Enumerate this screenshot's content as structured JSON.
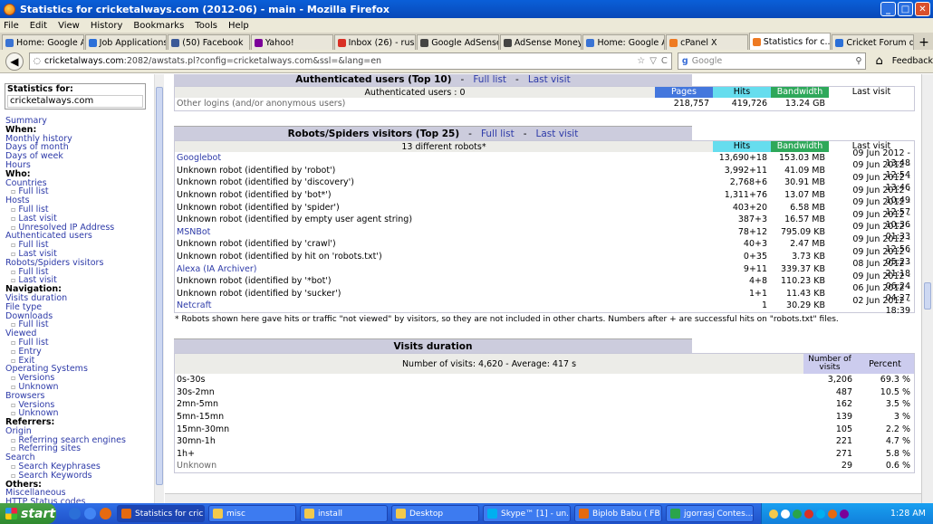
{
  "window": {
    "title": "Statistics for cricketalways.com (2012-06) - main - Mozilla Firefox",
    "btns": [
      "_",
      "□",
      "✕"
    ]
  },
  "menu": [
    "File",
    "Edit",
    "View",
    "History",
    "Bookmarks",
    "Tools",
    "Help"
  ],
  "tabs": [
    {
      "label": "Home: Google Ad...",
      "color": "#3a73d4",
      "active": false
    },
    {
      "label": "Job Applications -...",
      "color": "#2b6fd8",
      "active": false
    },
    {
      "label": "(50) Facebook",
      "color": "#3b5998",
      "active": false
    },
    {
      "label": "Yahoo!",
      "color": "#7b0099",
      "active": false
    },
    {
      "label": "Inbox (26) - russ...",
      "color": "#d93025",
      "active": false
    },
    {
      "label": "Google AdSense ...",
      "color": "#444444",
      "active": false
    },
    {
      "label": "AdSense Money: ...",
      "color": "#444444",
      "active": false
    },
    {
      "label": "Home: Google Ad...",
      "color": "#3a73d4",
      "active": false
    },
    {
      "label": "cPanel X",
      "color": "#ee7a22",
      "active": false
    },
    {
      "label": "Statistics for c...",
      "color": "#ee7a22",
      "active": true
    },
    {
      "label": "Cricket Forum dis...",
      "color": "#2b6fd8",
      "active": false
    }
  ],
  "new_tab": "+",
  "nav": {
    "url_host": "cricketalways.com",
    "url_rest": ":2082/awstats.pl?config=cricketalways.com&ssl=&lang=en",
    "search_placeholder": "Google",
    "feedback": "Feedback",
    "star": "☆",
    "drop": "▽",
    "reload": "C"
  },
  "sidebar": {
    "stat_label": "Statistics for:",
    "stat_value": "cricketalways.com",
    "items": [
      {
        "t": "Summary",
        "k": "link"
      },
      {
        "t": "When:",
        "k": "h"
      },
      {
        "t": "Monthly history",
        "k": "link"
      },
      {
        "t": "Days of month",
        "k": "link"
      },
      {
        "t": "Days of week",
        "k": "link"
      },
      {
        "t": "Hours",
        "k": "link"
      },
      {
        "t": "Who:",
        "k": "h"
      },
      {
        "t": "Countries",
        "k": "link"
      },
      {
        "t": "Full list",
        "k": "sub"
      },
      {
        "t": "Hosts",
        "k": "link"
      },
      {
        "t": "Full list",
        "k": "sub"
      },
      {
        "t": "Last visit",
        "k": "sub"
      },
      {
        "t": "Unresolved IP Address",
        "k": "sub"
      },
      {
        "t": "Authenticated users",
        "k": "link"
      },
      {
        "t": "Full list",
        "k": "sub"
      },
      {
        "t": "Last visit",
        "k": "sub"
      },
      {
        "t": "Robots/Spiders visitors",
        "k": "link"
      },
      {
        "t": "Full list",
        "k": "sub"
      },
      {
        "t": "Last visit",
        "k": "sub"
      },
      {
        "t": "Navigation:",
        "k": "h"
      },
      {
        "t": "Visits duration",
        "k": "link"
      },
      {
        "t": "File type",
        "k": "link"
      },
      {
        "t": "Downloads",
        "k": "link"
      },
      {
        "t": "Full list",
        "k": "sub"
      },
      {
        "t": "Viewed",
        "k": "link"
      },
      {
        "t": "Full list",
        "k": "sub"
      },
      {
        "t": "Entry",
        "k": "sub"
      },
      {
        "t": "Exit",
        "k": "sub"
      },
      {
        "t": "Operating Systems",
        "k": "link"
      },
      {
        "t": "Versions",
        "k": "sub"
      },
      {
        "t": "Unknown",
        "k": "sub"
      },
      {
        "t": "Browsers",
        "k": "link"
      },
      {
        "t": "Versions",
        "k": "sub"
      },
      {
        "t": "Unknown",
        "k": "sub"
      },
      {
        "t": "Referrers:",
        "k": "h"
      },
      {
        "t": "Origin",
        "k": "link"
      },
      {
        "t": "Referring search engines",
        "k": "sub"
      },
      {
        "t": "Referring sites",
        "k": "sub"
      },
      {
        "t": "Search",
        "k": "link"
      },
      {
        "t": "Search Keyphrases",
        "k": "sub"
      },
      {
        "t": "Search Keywords",
        "k": "sub"
      },
      {
        "t": "Others:",
        "k": "h"
      },
      {
        "t": "Miscellaneous",
        "k": "link"
      },
      {
        "t": "HTTP Status codes",
        "k": "link"
      }
    ]
  },
  "auth": {
    "title": "Authenticated users (Top 10)",
    "full": "Full list",
    "last": "Last visit",
    "sep": "-",
    "summary": "Authenticated users : 0",
    "cols": {
      "pages": "Pages",
      "hits": "Hits",
      "bw": "Bandwidth",
      "last": "Last visit"
    },
    "other": {
      "label": "Other logins (and/or anonymous users)",
      "pages": "218,757",
      "hits": "419,726",
      "bw": "13.24 GB",
      "last": ""
    }
  },
  "robots": {
    "title": "Robots/Spiders visitors (Top 25)",
    "full": "Full list",
    "last": "Last visit",
    "sep": "-",
    "summary": "13 different robots*",
    "cols": {
      "hits": "Hits",
      "bw": "Bandwidth",
      "last": "Last visit"
    },
    "rows": [
      {
        "name": "Googlebot",
        "link": true,
        "hits": "13,690+18",
        "bw": "153.03 MB",
        "last": "09 Jun 2012 - 13:48"
      },
      {
        "name": "Unknown robot (identified by 'robot')",
        "link": false,
        "hits": "3,992+11",
        "bw": "41.09 MB",
        "last": "09 Jun 2012 - 12:54"
      },
      {
        "name": "Unknown robot (identified by 'discovery')",
        "link": false,
        "hits": "2,768+6",
        "bw": "30.91 MB",
        "last": "09 Jun 2012 - 13:46"
      },
      {
        "name": "Unknown robot (identified by 'bot*')",
        "link": false,
        "hits": "1,311+76",
        "bw": "13.07 MB",
        "last": "09 Jun 2012 - 10:49"
      },
      {
        "name": "Unknown robot (identified by 'spider')",
        "link": false,
        "hits": "403+20",
        "bw": "6.58 MB",
        "last": "09 Jun 2012 - 12:57"
      },
      {
        "name": "Unknown robot (identified by empty user agent string)",
        "link": false,
        "hits": "387+3",
        "bw": "16.57 MB",
        "last": "09 Jun 2012 - 10:36"
      },
      {
        "name": "MSNBot",
        "link": true,
        "hits": "78+12",
        "bw": "795.09 KB",
        "last": "09 Jun 2012 - 01:33"
      },
      {
        "name": "Unknown robot (identified by 'crawl')",
        "link": false,
        "hits": "40+3",
        "bw": "2.47 MB",
        "last": "09 Jun 2012 - 12:56"
      },
      {
        "name": "Unknown robot (identified by hit on 'robots.txt')",
        "link": false,
        "hits": "0+35",
        "bw": "3.73 KB",
        "last": "09 Jun 2012 - 05:23"
      },
      {
        "name": "Alexa (IA Archiver)",
        "link": true,
        "hits": "9+11",
        "bw": "339.37 KB",
        "last": "08 Jun 2012 - 21:18"
      },
      {
        "name": "Unknown robot (identified by '*bot')",
        "link": false,
        "hits": "4+8",
        "bw": "110.23 KB",
        "last": "09 Jun 2012 - 06:24"
      },
      {
        "name": "Unknown robot (identified by 'sucker')",
        "link": false,
        "hits": "1+1",
        "bw": "11.43 KB",
        "last": "06 Jun 2012 - 04:27"
      },
      {
        "name": "Netcraft",
        "link": true,
        "hits": "1",
        "bw": "30.29 KB",
        "last": "02 Jun 2012 - 18:39"
      }
    ],
    "note": "* Robots shown here gave hits or traffic \"not viewed\" by visitors, so they are not included in other charts. Numbers after + are successful hits on \"robots.txt\" files."
  },
  "visits": {
    "title": "Visits duration",
    "summary": "Number of visits: 4,620 - Average: 417 s",
    "cols": {
      "num": "Number of visits",
      "pct": "Percent"
    },
    "rows": [
      {
        "range": "0s-30s",
        "num": "3,206",
        "pct": "69.3 %",
        "gray": false
      },
      {
        "range": "30s-2mn",
        "num": "487",
        "pct": "10.5 %",
        "gray": false
      },
      {
        "range": "2mn-5mn",
        "num": "162",
        "pct": "3.5 %",
        "gray": false
      },
      {
        "range": "5mn-15mn",
        "num": "139",
        "pct": "3 %",
        "gray": false
      },
      {
        "range": "15mn-30mn",
        "num": "105",
        "pct": "2.2 %",
        "gray": false
      },
      {
        "range": "30mn-1h",
        "num": "221",
        "pct": "4.7 %",
        "gray": false
      },
      {
        "range": "1h+",
        "num": "271",
        "pct": "5.8 %",
        "gray": false
      },
      {
        "range": "Unknown",
        "num": "29",
        "pct": "0.6 %",
        "gray": true
      }
    ]
  },
  "taskbar": {
    "start": "start",
    "buttons": [
      {
        "label": "Statistics for cric...",
        "color": "#e56a10",
        "active": true
      },
      {
        "label": "misc",
        "color": "#f2c94c",
        "active": false
      },
      {
        "label": "install",
        "color": "#f2c94c",
        "active": false
      },
      {
        "label": "Desktop",
        "color": "#f2c94c",
        "active": false
      },
      {
        "label": "Skype™ [1] - un...",
        "color": "#00aff0",
        "active": false
      },
      {
        "label": "Biplob Babu ( FB ...",
        "color": "#e56a10",
        "active": false
      },
      {
        "label": "jgorrasj Contes...",
        "color": "#2aa44a",
        "active": false
      }
    ],
    "clock": "1:28 AM"
  }
}
